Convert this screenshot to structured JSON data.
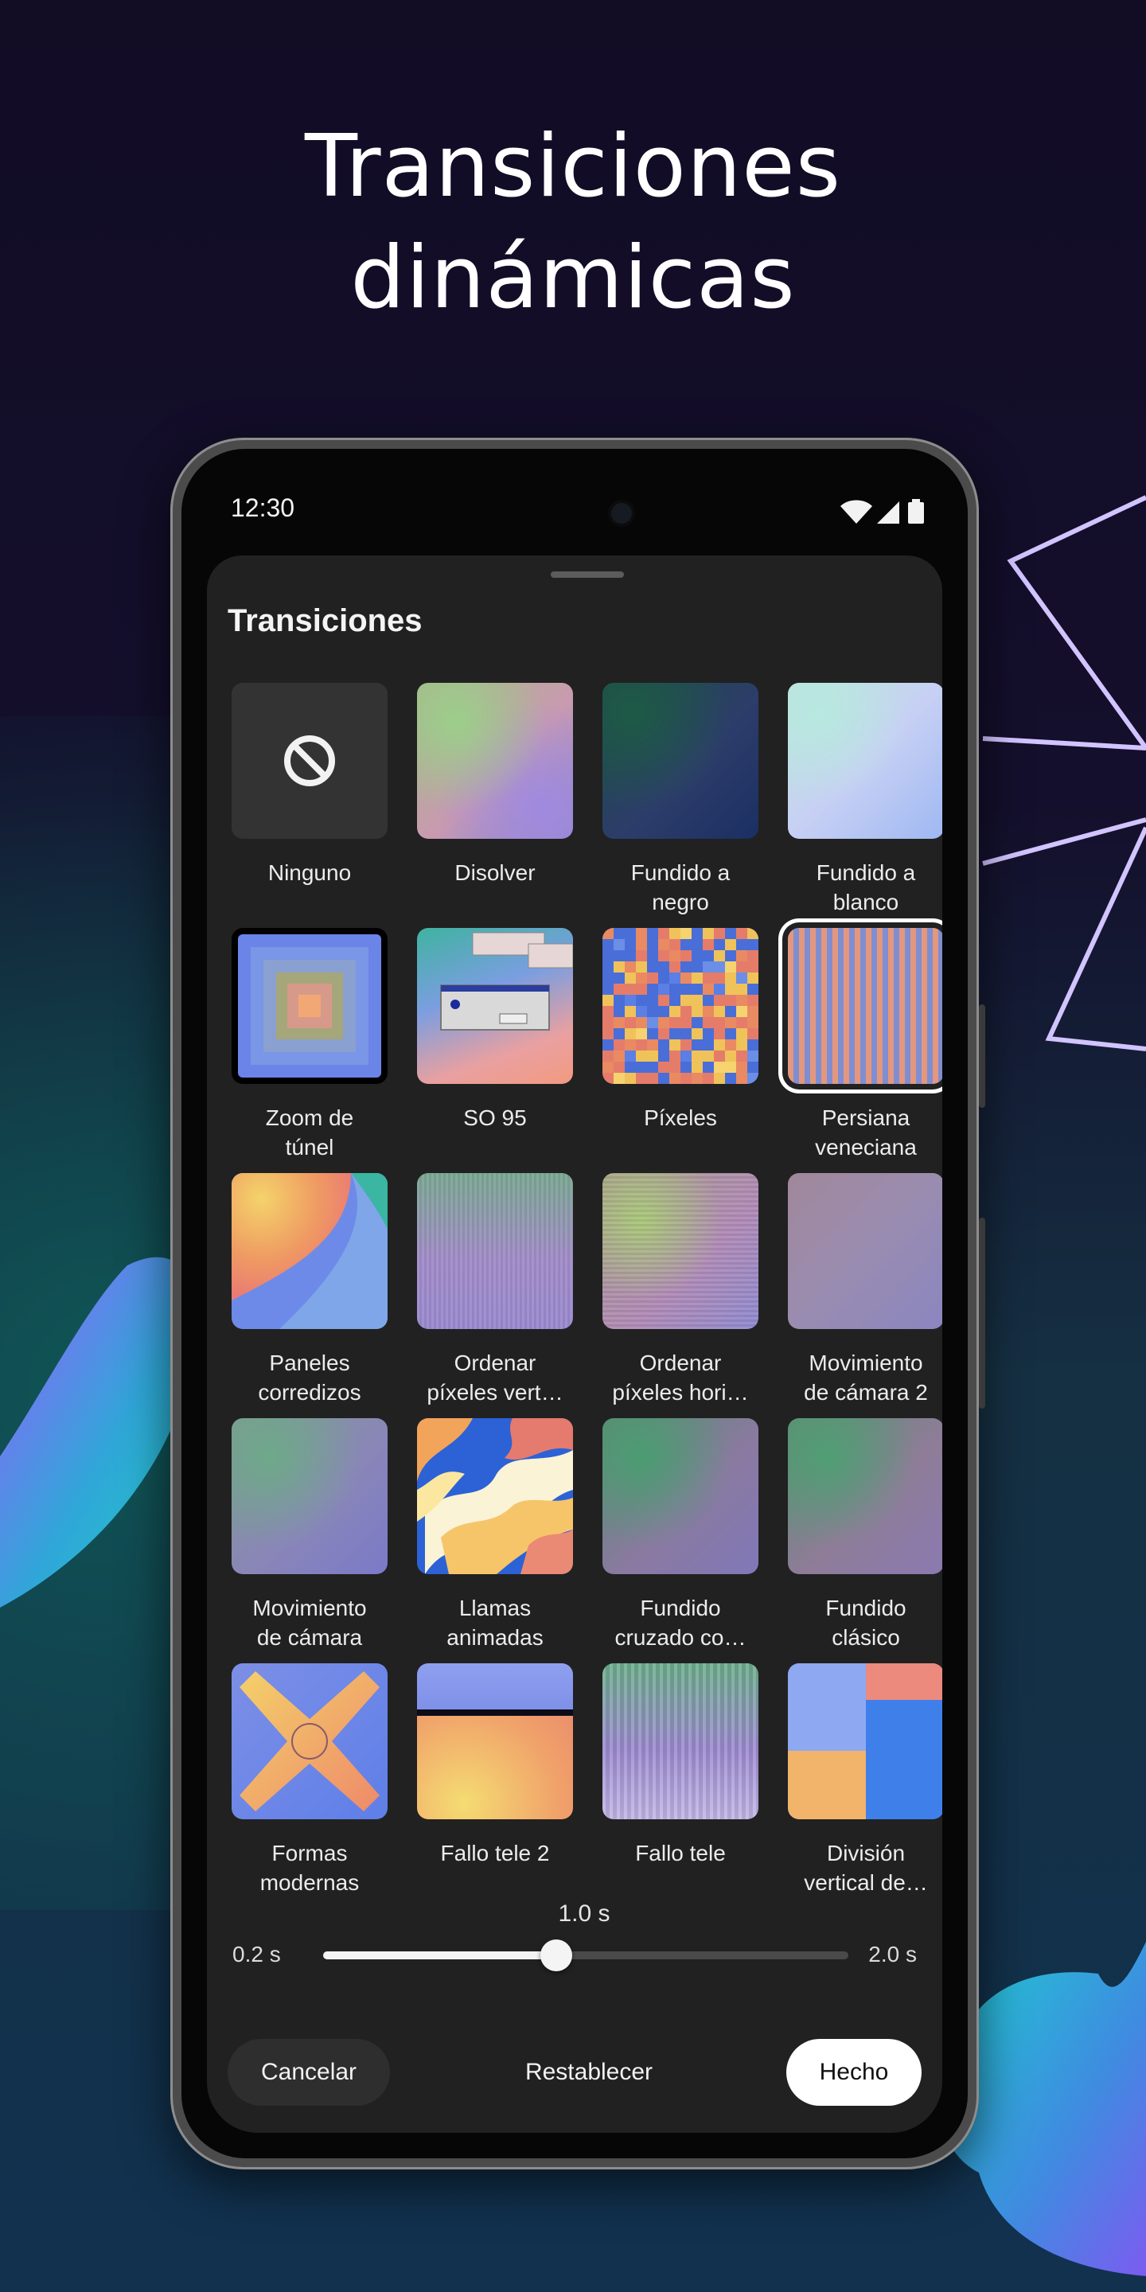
{
  "headline": {
    "line1": "Transiciones",
    "line2": "dinámicas"
  },
  "status_bar": {
    "time": "12:30"
  },
  "sheet": {
    "title": "Transiciones",
    "tiles": [
      {
        "id": "none",
        "label": "Ninguno",
        "icon": "block-icon"
      },
      {
        "id": "dissolve",
        "label": "Disolver"
      },
      {
        "id": "fade-black",
        "label": "Fundido a\nnegro"
      },
      {
        "id": "fade-white",
        "label": "Fundido a\nblanco"
      },
      {
        "id": "tunnel",
        "label": "Zoom de\ntúnel"
      },
      {
        "id": "so95",
        "label": "SO 95"
      },
      {
        "id": "pixels",
        "label": "Píxeles"
      },
      {
        "id": "blinds",
        "label": "Persiana\nveneciana",
        "selected": true
      },
      {
        "id": "panels",
        "label": "Paneles\ncorredizos"
      },
      {
        "id": "sort-vert",
        "label": "Ordenar\npíxeles vert…"
      },
      {
        "id": "sort-hori",
        "label": "Ordenar\npíxeles hori…"
      },
      {
        "id": "camera2",
        "label": "Movimiento\nde cámara 2"
      },
      {
        "id": "camera",
        "label": "Movimiento\nde cámara"
      },
      {
        "id": "flames",
        "label": "Llamas\nanimadas"
      },
      {
        "id": "crossfade",
        "label": "Fundido\ncruzado co…"
      },
      {
        "id": "classic",
        "label": "Fundido\nclásico"
      },
      {
        "id": "shapes",
        "label": "Formas\nmodernas"
      },
      {
        "id": "tv2",
        "label": "Fallo tele 2"
      },
      {
        "id": "tv",
        "label": "Fallo tele"
      },
      {
        "id": "split",
        "label": "División\nvertical de…"
      }
    ]
  },
  "slider": {
    "value_label": "1.0 s",
    "min_label": "0.2 s",
    "max_label": "2.0 s",
    "value": 1.0,
    "min": 0.2,
    "max": 2.0
  },
  "actions": {
    "cancel": "Cancelar",
    "reset": "Restablecer",
    "done": "Hecho"
  },
  "colors": {
    "background": "#140f2a",
    "sheet": "#212121",
    "accent_lavender": "#d2c4ff",
    "primary_button": "#ffffff"
  }
}
